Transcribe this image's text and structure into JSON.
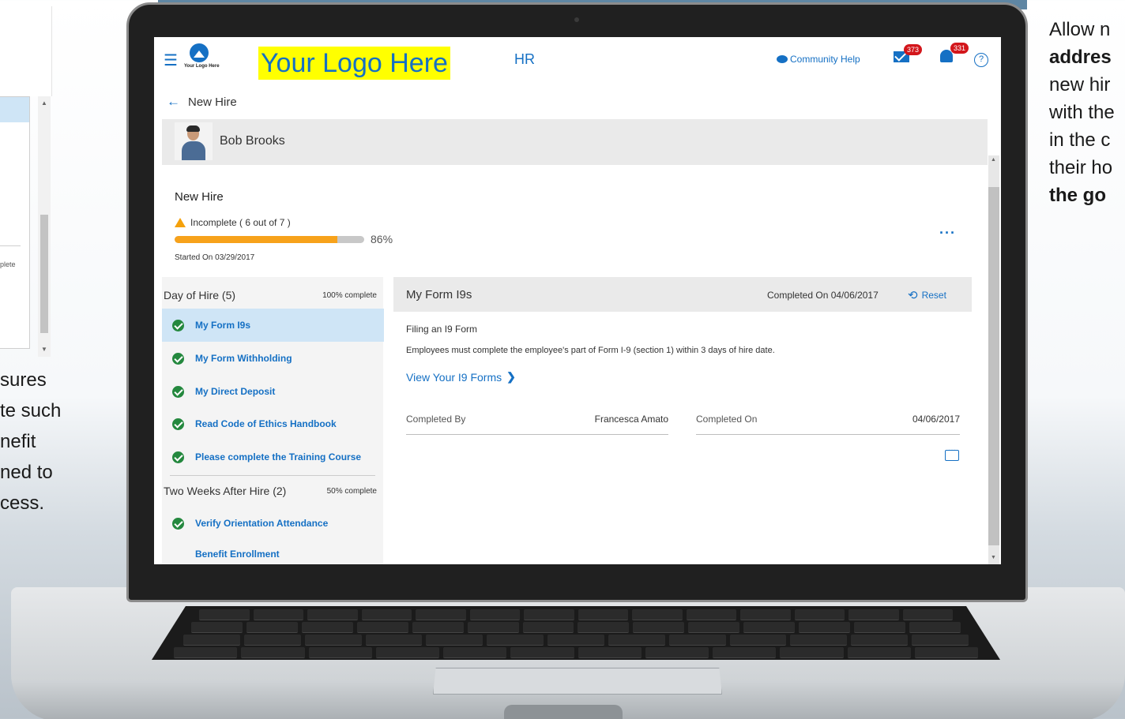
{
  "background": {
    "left_snippet": "plete",
    "left_caption_lines": [
      "sures",
      "te such",
      "nefit",
      "ned to",
      "cess."
    ],
    "right_caption": {
      "line1": "Allow n",
      "line2_bold": "addres",
      "line3": "new hir",
      "line4": "with the",
      "line5": "in the c",
      "line6": "their ho",
      "line7_bold": "the go"
    }
  },
  "header": {
    "logo_small_text": "Your Logo Here",
    "logo_text": "Your Logo Here",
    "module": "HR",
    "community_help": "Community Help",
    "mail_badge": "373",
    "bell_badge": "331",
    "help_symbol": "?"
  },
  "page": {
    "back_title": "New Hire"
  },
  "employee": {
    "name": "Bob Brooks"
  },
  "onboarding": {
    "title": "New Hire",
    "status": "Incomplete ( 6 out of 7 )",
    "progress_percent": 86,
    "progress_label": "86%",
    "started": "Started On 03/29/2017",
    "more": "···"
  },
  "sections": [
    {
      "title": "Day of Hire (5)",
      "pct": "100% complete",
      "tasks": [
        {
          "label": "My Form I9s",
          "done": true
        },
        {
          "label": "My Form Withholding",
          "done": true
        },
        {
          "label": "My Direct Deposit",
          "done": true
        },
        {
          "label": "Read Code of Ethics Handbook",
          "done": true
        },
        {
          "label": "Please complete the Training Course",
          "done": true
        }
      ]
    },
    {
      "title": "Two Weeks After Hire (2)",
      "pct": "50% complete",
      "tasks": [
        {
          "label": "Verify Orientation Attendance",
          "done": true
        },
        {
          "label": "Benefit Enrollment",
          "done": false
        }
      ]
    }
  ],
  "detail": {
    "title": "My Form I9s",
    "completed_on_header": "Completed On 04/06/2017",
    "reset_label": "Reset",
    "filing": "Filing an I9 Form",
    "note": "Employees must complete the employee's part of Form I-9 (section 1) within 3 days of hire date.",
    "view_link": "View Your I9 Forms",
    "completed_by_label": "Completed By",
    "completed_by_value": "Francesca Amato",
    "completed_on_label": "Completed On",
    "completed_on_value": "04/06/2017"
  },
  "colors": {
    "accent": "#1570c4",
    "progress": "#f7a21b",
    "success": "#24883e",
    "badge": "#d3161b",
    "logo_highlight": "#ffff00"
  }
}
